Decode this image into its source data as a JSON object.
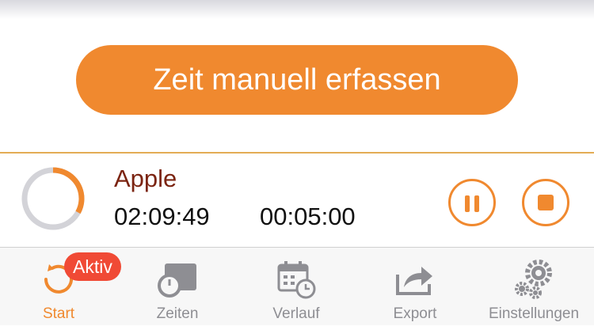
{
  "manual_entry": {
    "label": "Zeit manuell erfassen"
  },
  "timer": {
    "project": "Apple",
    "elapsed": "02:09:49",
    "interval": "00:05:00",
    "progress": 0.33
  },
  "tabs": [
    {
      "label": "Start",
      "icon": "timer-restart-icon",
      "active": true,
      "badge": "Aktiv"
    },
    {
      "label": "Zeiten",
      "icon": "stopwatch-box-icon",
      "active": false
    },
    {
      "label": "Verlauf",
      "icon": "calendar-clock-icon",
      "active": false
    },
    {
      "label": "Export",
      "icon": "share-export-icon",
      "active": false
    },
    {
      "label": "Einstellungen",
      "icon": "gears-icon",
      "active": false
    }
  ],
  "colors": {
    "accent": "#f0892f",
    "project_text": "#7b2411",
    "badge": "#f04a35",
    "tab_inactive": "#8e8e93",
    "divider": "#e3ac55"
  }
}
